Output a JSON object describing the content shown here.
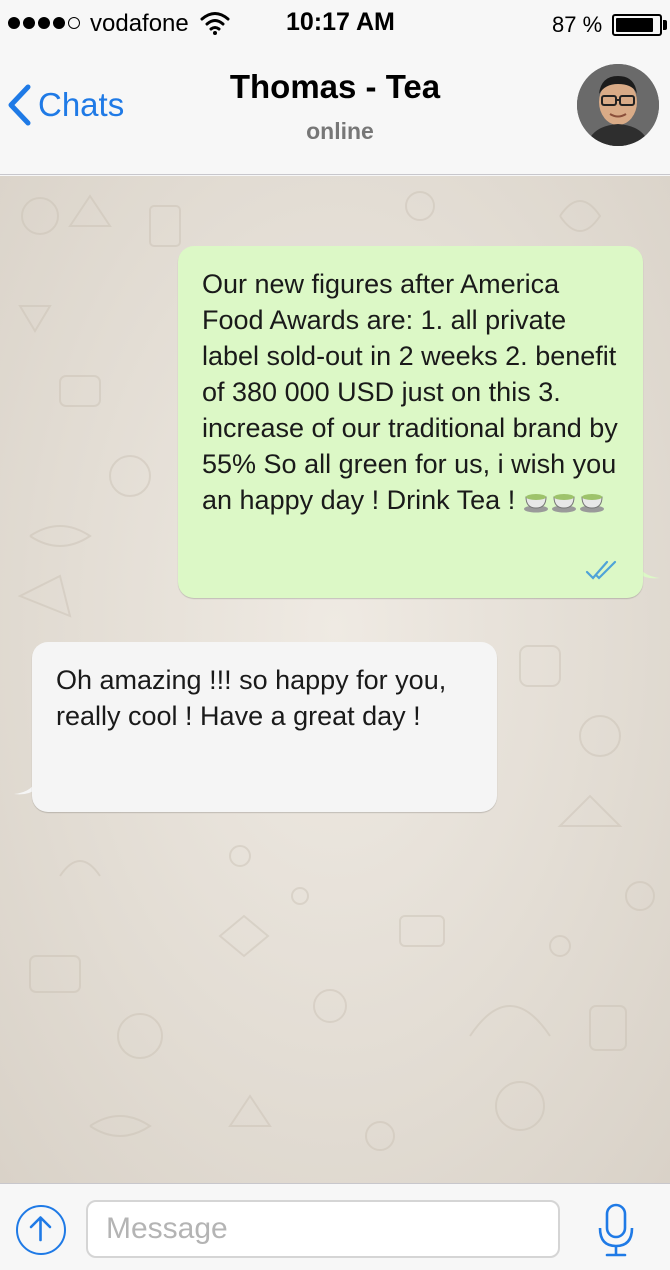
{
  "status_bar": {
    "signal_bars_filled": 4,
    "signal_bars_total": 5,
    "carrier": "vodafone",
    "time": "10:17 AM",
    "battery_percent": "87 %",
    "battery_level": 0.87
  },
  "header": {
    "back_label": "Chats",
    "contact_name": "Thomas - Tea",
    "contact_status": "online"
  },
  "messages": [
    {
      "direction": "outgoing",
      "text": "Our new figures after America Food Awards are: 1. all private label sold-out in 2 weeks 2. benefit of 380 000 USD just on this 3. increase of our traditional brand by 55% So all green for us, i wish you an happy day ! Drink Tea !",
      "emoji": "teacup-icon x3",
      "status": "read"
    },
    {
      "direction": "incoming",
      "text": "Oh amazing !!! so happy for you, really cool ! Have a great day !"
    }
  ],
  "input": {
    "placeholder": "Message"
  },
  "colors": {
    "accent": "#1f7ae6",
    "outgoing_bubble": "#dcf8c6",
    "incoming_bubble": "#f5f5f5",
    "read_ticks": "#4fa3d8"
  }
}
